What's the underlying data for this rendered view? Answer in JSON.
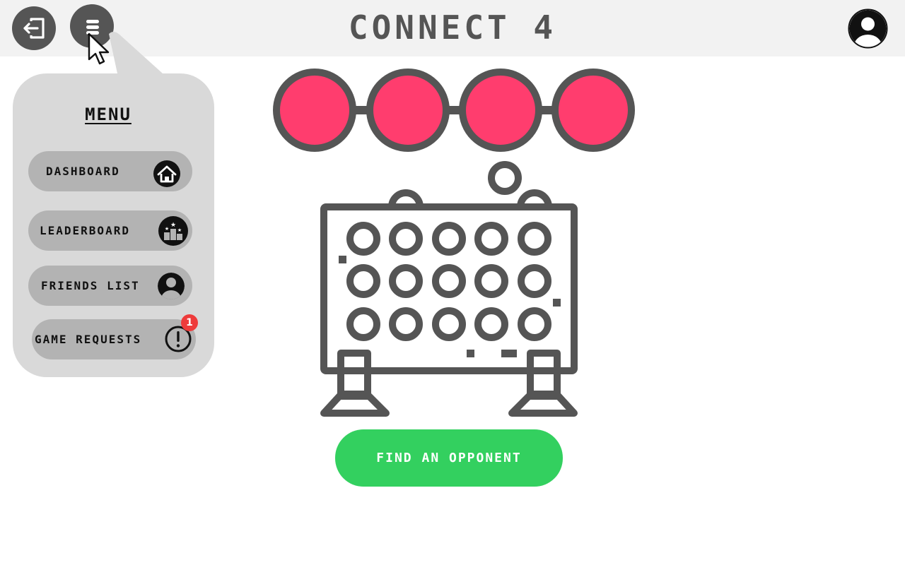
{
  "app": {
    "title": "CONNECT 4"
  },
  "header": {
    "logout_icon": "logout-icon",
    "menu_icon": "menu-icon",
    "profile_icon": "user-avatar-icon"
  },
  "menu": {
    "heading": "MENU",
    "items": [
      {
        "label": "DASHBOARD",
        "icon": "home-icon"
      },
      {
        "label": "LEADERBOARD",
        "icon": "podium-icon"
      },
      {
        "label": "FRIENDS LIST",
        "icon": "user-icon"
      },
      {
        "label": "GAME REQUESTS",
        "icon": "alert-icon",
        "badge": "1"
      }
    ]
  },
  "main": {
    "winning_chips": 4,
    "find_opponent_label": "FIND AN OPPONENT"
  },
  "colors": {
    "chip": "#ff3d6e",
    "outline": "#555555",
    "menu_bg": "#d9d9d9",
    "menu_item_bg": "#b3b3b3",
    "accent_green": "#33d05f",
    "badge_red": "#ee3b3b"
  }
}
